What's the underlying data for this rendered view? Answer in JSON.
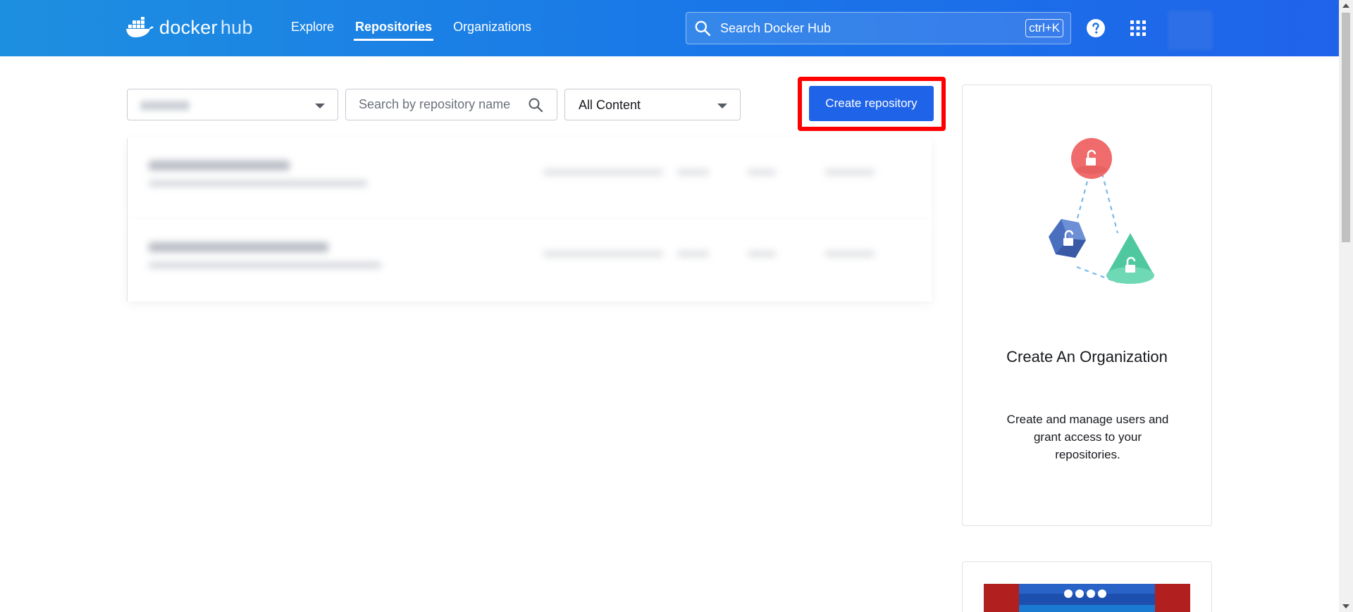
{
  "header": {
    "logo_text": "docker",
    "logo_hub": "hub",
    "nav": [
      {
        "label": "Explore",
        "active": false
      },
      {
        "label": "Repositories",
        "active": true
      },
      {
        "label": "Organizations",
        "active": false
      }
    ],
    "search_placeholder": "Search Docker Hub",
    "search_shortcut": "ctrl+K",
    "help_icon": "help-circle-icon",
    "apps_icon": "apps-grid-icon",
    "accent_color": "#1f63e8"
  },
  "toolbar": {
    "namespace_icon": "chevron-down-icon",
    "repo_search_placeholder": "Search by repository name",
    "content_filter_value": "All Content",
    "create_button_label": "Create repository",
    "highlight_color": "#ff0000"
  },
  "org_card": {
    "title": "Create An Organization",
    "description": "Create and manage users and grant access to your repositories."
  }
}
